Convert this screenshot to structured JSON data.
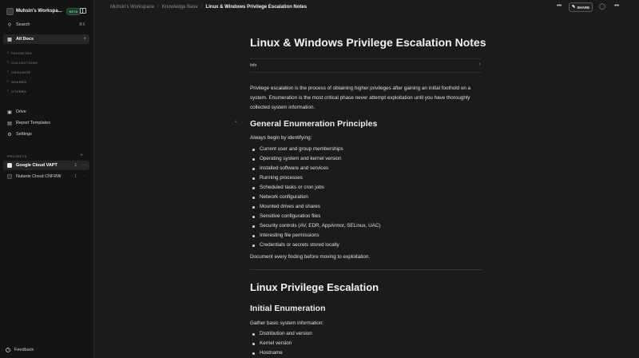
{
  "workspace": {
    "name": "Muhsin's Workspa...",
    "badge": "BETA"
  },
  "sidebar": {
    "search_label": "Search",
    "search_shortcut": "⌘K",
    "all_docs_label": "All Docs",
    "sections": [
      "FAVORITES",
      "COLLECTIONS",
      "ORGANIZE",
      "SHARED",
      "OTHERS"
    ],
    "links": [
      {
        "label": "Drive",
        "icon": "drive-icon"
      },
      {
        "label": "Report Templates",
        "icon": "template-icon"
      },
      {
        "label": "Settings",
        "icon": "gear-icon"
      }
    ],
    "projects_heading": "PROJECTS",
    "projects": [
      {
        "label": "Google Cloud VAPT",
        "count": "1",
        "active": true
      },
      {
        "label": "Nutanix Cloud CNFRW",
        "count": "1",
        "active": false
      }
    ],
    "feedback_label": "Feedback"
  },
  "breadcrumb": {
    "items": [
      "Muhsin's Workspace",
      "Knowledge Base"
    ],
    "current": "Linux & Windows Privilege Escalation Notes"
  },
  "toolbar": {
    "share_label": "SHARE"
  },
  "document": {
    "title": "Linux & Windows Privilege Escalation Notes",
    "info_label": "Info",
    "intro": "Privilege escalation is the process of obtaining higher privileges after gaining an initial foothold on a system. Enumeration is the most critical phase never attempt exploitation until you have thoroughly collected system information.",
    "section1_heading": "General Enumeration Principles",
    "section1_lead": "Always begin by identifying:",
    "section1_items": [
      "Current user and group memberships",
      "Operating system and kernel version",
      "Installed software and services",
      "Running processes",
      "Scheduled tasks or cron jobs",
      "Network configuration",
      "Mounted drives and shares",
      "Sensitive configuration files",
      "Security controls (AV, EDR, AppArmor, SELinux, UAC)",
      "Interesting file permissions",
      "Credentials or secrets stored locally"
    ],
    "section1_outro": "Document every finding before moving to exploitation.",
    "section2_heading": "Linux Privilege Escalation",
    "section3_heading": "Initial Enumeration",
    "section3_lead": "Gather basic system information:",
    "section3_items": [
      "Distribution and version",
      "Kernel version",
      "Hostname"
    ]
  }
}
